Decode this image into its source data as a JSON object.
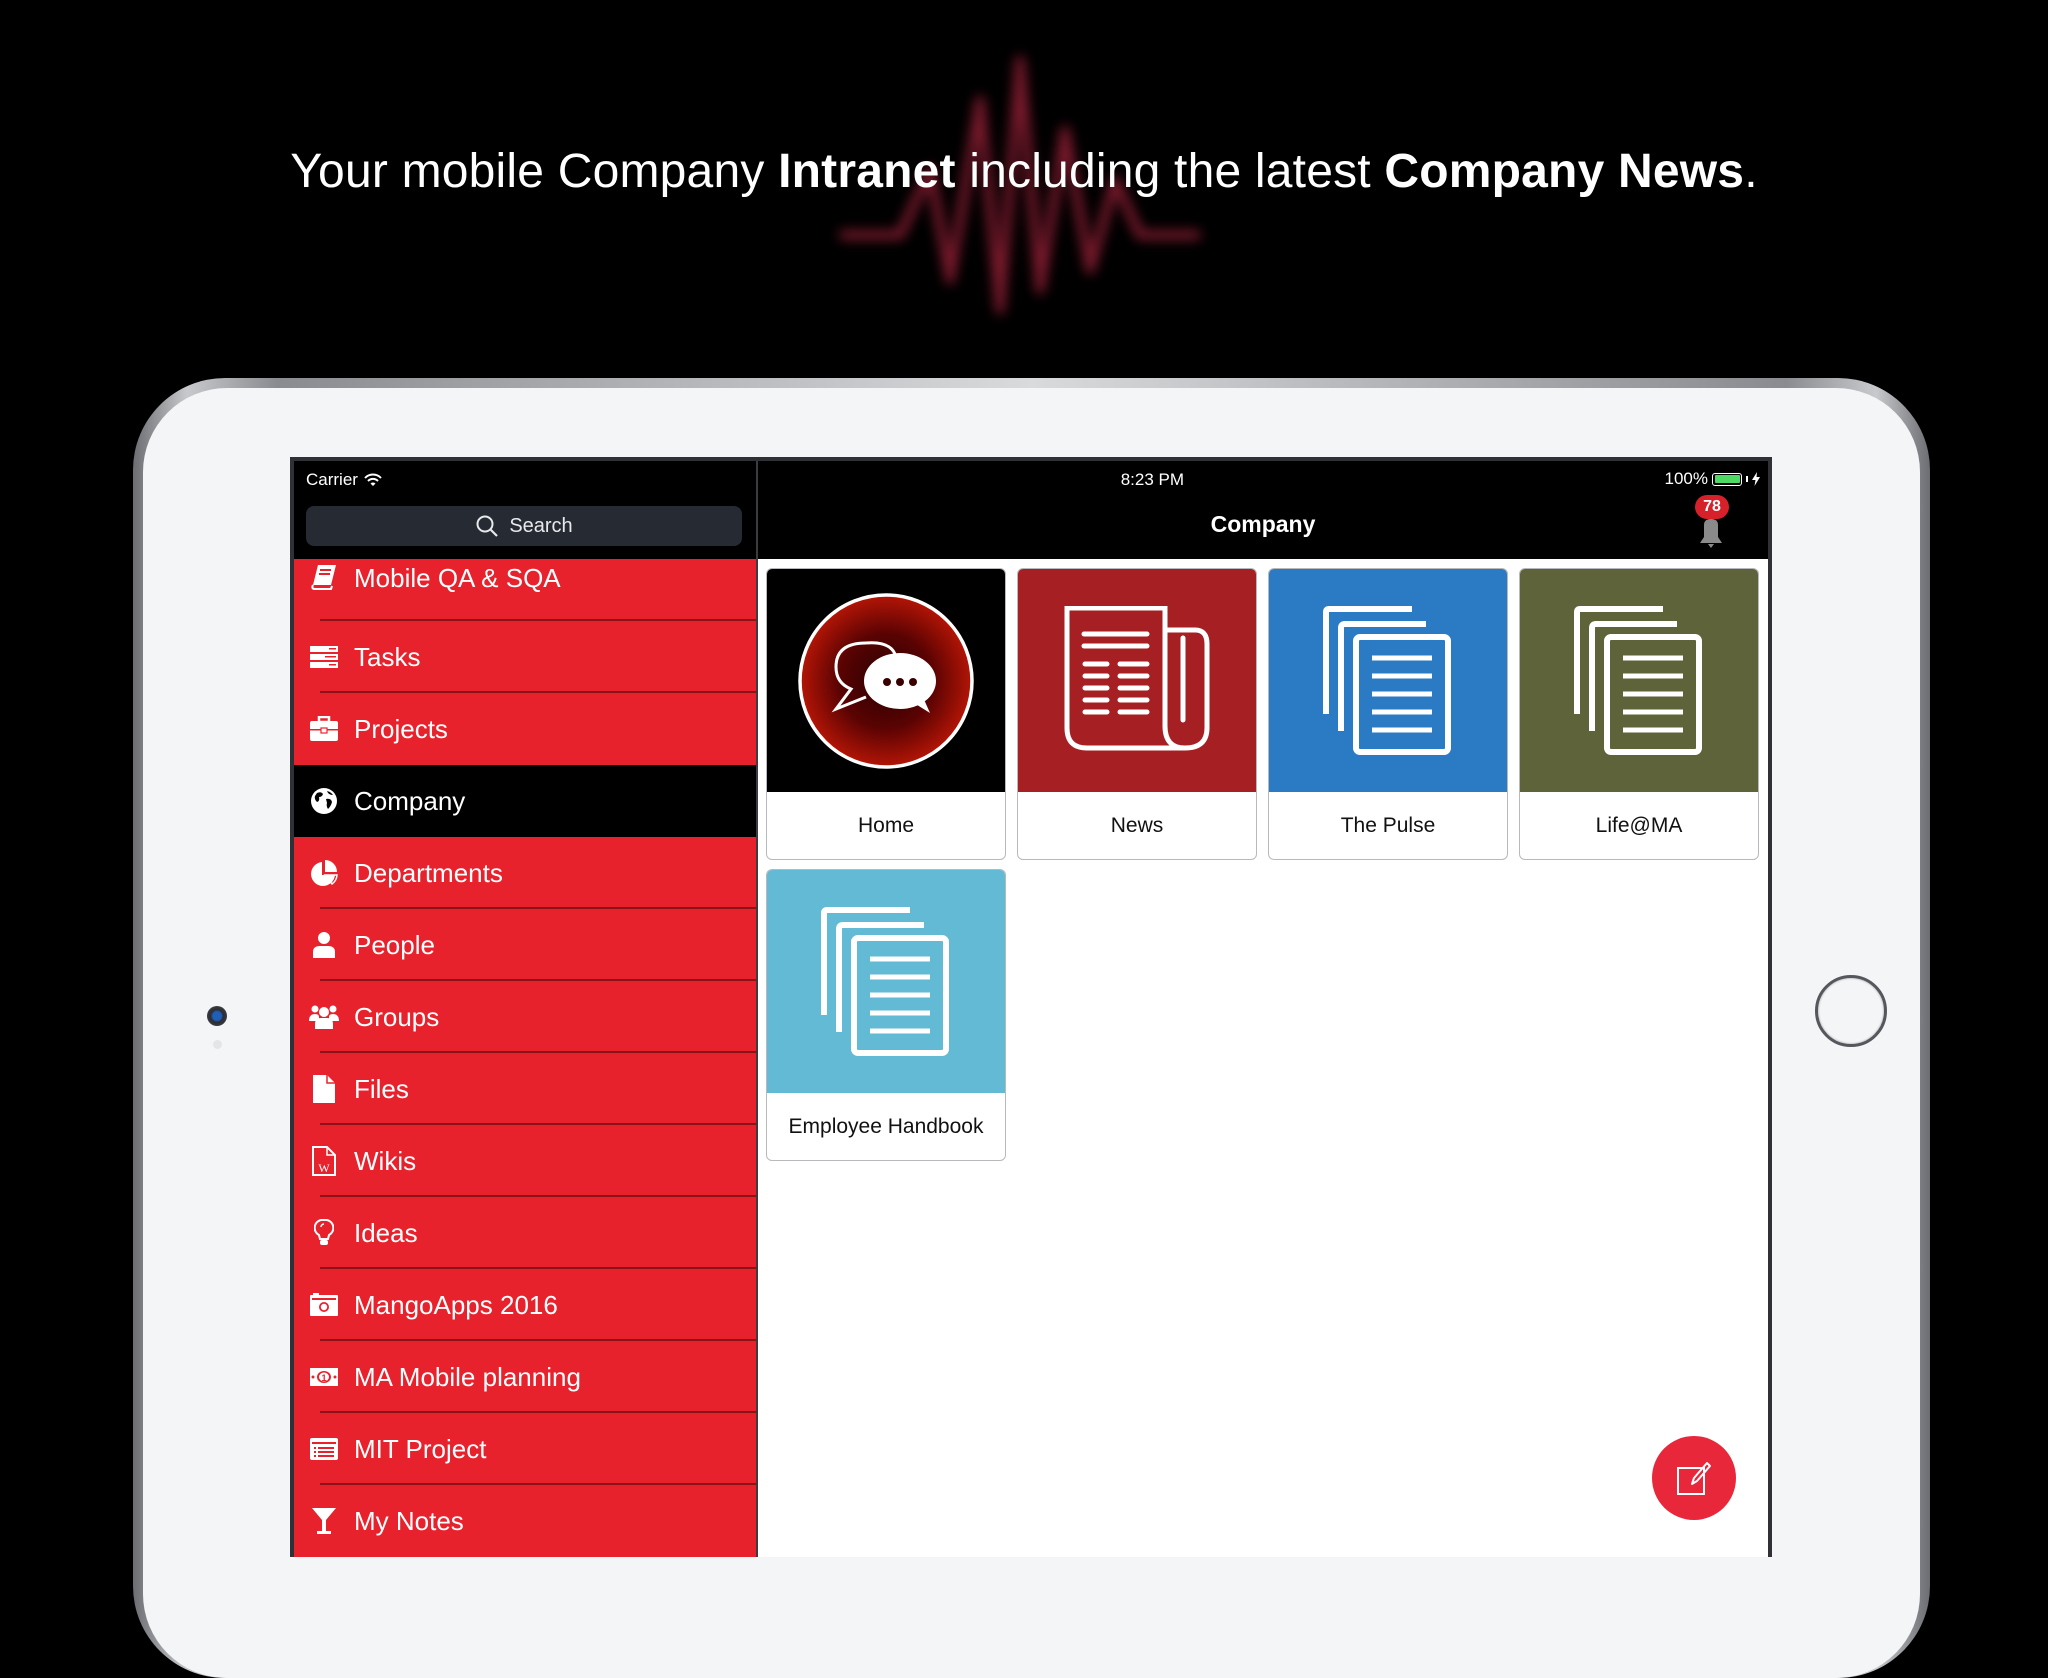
{
  "headline": {
    "part1": "Your mobile Company ",
    "bold1": "Intranet",
    "part2": " including the latest ",
    "bold2": "Company News",
    "part3": "."
  },
  "status_bar": {
    "carrier": "Carrier",
    "time": "8:23 PM",
    "battery": "100%",
    "battery_level": 1.0
  },
  "search": {
    "placeholder": "Search"
  },
  "header": {
    "title": "Company",
    "notification_count": "78"
  },
  "sidebar": {
    "active": "Company",
    "items": [
      {
        "label": "Mobile QA & SQA",
        "icon": "book-icon"
      },
      {
        "label": "Tasks",
        "icon": "tasks-icon"
      },
      {
        "label": "Projects",
        "icon": "briefcase-icon"
      },
      {
        "label": "Company",
        "icon": "globe-icon"
      },
      {
        "label": "Departments",
        "icon": "pie-chart-icon"
      },
      {
        "label": "People",
        "icon": "person-icon"
      },
      {
        "label": "Groups",
        "icon": "group-icon"
      },
      {
        "label": "Files",
        "icon": "file-icon"
      },
      {
        "label": "Wikis",
        "icon": "wiki-icon"
      },
      {
        "label": "Ideas",
        "icon": "lightbulb-icon"
      },
      {
        "label": "MangoApps 2016",
        "icon": "camera-icon"
      },
      {
        "label": "MA Mobile planning",
        "icon": "money-icon"
      },
      {
        "label": "MIT Project",
        "icon": "list-icon"
      },
      {
        "label": "My Notes",
        "icon": "cocktail-icon"
      }
    ]
  },
  "tiles": [
    {
      "label": "Home",
      "icon": "chat-bubbles-icon",
      "color": "#000000"
    },
    {
      "label": "News",
      "icon": "newspaper-icon",
      "color": "#a61f22"
    },
    {
      "label": "The Pulse",
      "icon": "documents-icon",
      "color": "#2b7bc4"
    },
    {
      "label": "Life@MA",
      "icon": "documents-icon",
      "color": "#5f633a"
    },
    {
      "label": "Employee Handbook",
      "icon": "documents-icon",
      "color": "#62bad4"
    }
  ],
  "colors": {
    "sidebar": "#e8222c",
    "accent": "#e8273b",
    "badge": "#d6202a"
  }
}
